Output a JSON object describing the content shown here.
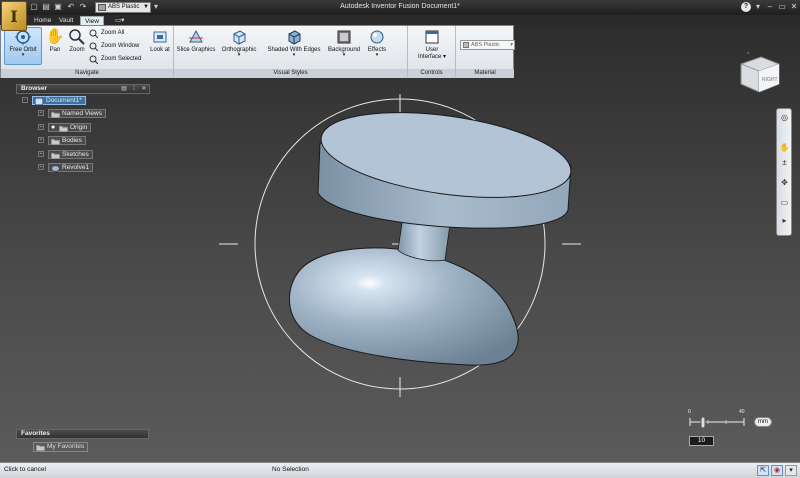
{
  "window": {
    "title": "Autodesk Inventor Fusion   Document1*",
    "logo_letter": "I",
    "material_quick": "ABS Plastic"
  },
  "tabs": [
    {
      "label": "Home",
      "active": false
    },
    {
      "label": "Vault",
      "active": false
    },
    {
      "label": "View",
      "active": true
    }
  ],
  "ribbon": {
    "navigate": {
      "label": "Navigate",
      "free_orbit": "Free Orbit",
      "pan": "Pan",
      "zoom": "Zoom",
      "zoom_all": "Zoom All",
      "zoom_window": "Zoom Window",
      "zoom_selected": "Zoom Selected",
      "look_at": "Look at"
    },
    "visual_styles": {
      "label": "Visual Styles",
      "slice_graphics": "Slice Graphics",
      "orthographic": "Orthographic",
      "shaded_with_edges": "Shaded With Edges",
      "background": "Background",
      "effects": "Effects"
    },
    "controls": {
      "label": "Controls",
      "user_interface_line1": "User",
      "user_interface_line2": "Interface"
    },
    "material": {
      "label": "Material",
      "value": "ABS Plastic"
    }
  },
  "browser": {
    "title": "Browser",
    "items": [
      {
        "label": "Document1*",
        "selected": true
      },
      {
        "label": "Named Views"
      },
      {
        "label": "Origin"
      },
      {
        "label": "Bodies"
      },
      {
        "label": "Sketches"
      },
      {
        "label": "Revolve1"
      }
    ]
  },
  "favorites": {
    "title": "Favorites",
    "item": "My Favorites"
  },
  "viewcube": {
    "face": "RIGHT"
  },
  "scale": {
    "min": "0",
    "max": "40",
    "value": "10",
    "unit": "mm"
  },
  "status": {
    "left": "Click to cancel",
    "middle": "No Selection"
  },
  "colors": {
    "model_fill": "#a9bccd",
    "ribbon_bg": "#e6eaee",
    "selection": "#3d6fa3"
  }
}
